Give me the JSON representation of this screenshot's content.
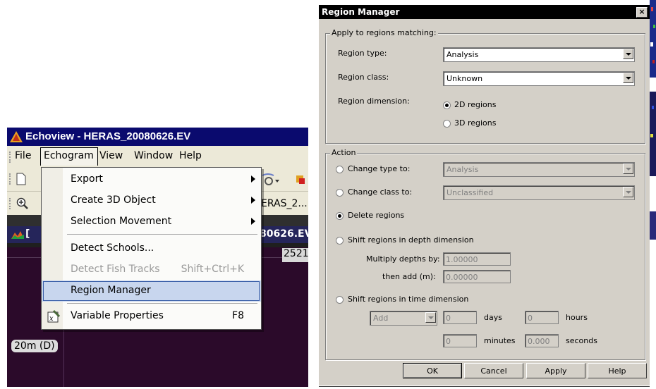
{
  "echoview": {
    "title": "Echoview - HERAS_20080626.EV",
    "menubar": [
      "File",
      "Echogram",
      "View",
      "Window",
      "Help"
    ],
    "toolbar_text": "ERAS_2...",
    "child_title": "80626.EV",
    "sub_value": "2521",
    "depth_label": "20m (D)",
    "menu": {
      "items": [
        {
          "label": "Export",
          "submenu": true
        },
        {
          "label": "Create 3D Object",
          "submenu": true
        },
        {
          "label": "Selection Movement",
          "submenu": true
        },
        {
          "label": "Detect Schools..."
        },
        {
          "label": "Detect Fish Tracks",
          "shortcut": "Shift+Ctrl+K",
          "disabled": true
        },
        {
          "label": "Region Manager",
          "selected": true
        },
        {
          "label": "Variable Properties",
          "shortcut": "F8"
        }
      ]
    },
    "colors": {
      "title_bg": "#0a0a6e",
      "echogram_bg": "#2b0a2a",
      "selection": "#c8d6ee"
    }
  },
  "dialog": {
    "title": "Region Manager",
    "close_glyph": "×",
    "apply_group": {
      "title": "Apply to regions matching:",
      "region_type_label": "Region type:",
      "region_type_value": "Analysis",
      "region_class_label": "Region class:",
      "region_class_value": "Unknown",
      "region_dimension_label": "Region dimension:",
      "dim_2d": "2D regions",
      "dim_3d": "3D regions"
    },
    "action_group": {
      "title": "Action",
      "change_type_label": "Change type to:",
      "change_type_value": "Analysis",
      "change_class_label": "Change class to:",
      "change_class_value": "Unclassified",
      "delete_label": "Delete regions",
      "shift_depth_label": "Shift regions in depth dimension",
      "multiply_label": "Multiply depths by:",
      "multiply_value": "1.00000",
      "then_add_label": "then add (m):",
      "then_add_value": "0.00000",
      "shift_time_label": "Shift regions in time dimension",
      "op_value": "Add",
      "days_value": "0",
      "days_label": "days",
      "hours_value": "0",
      "hours_label": "hours",
      "minutes_value": "0",
      "minutes_label": "minutes",
      "seconds_value": "0.000",
      "seconds_label": "seconds"
    },
    "buttons": {
      "ok": "OK",
      "cancel": "Cancel",
      "apply": "Apply",
      "help": "Help"
    }
  }
}
